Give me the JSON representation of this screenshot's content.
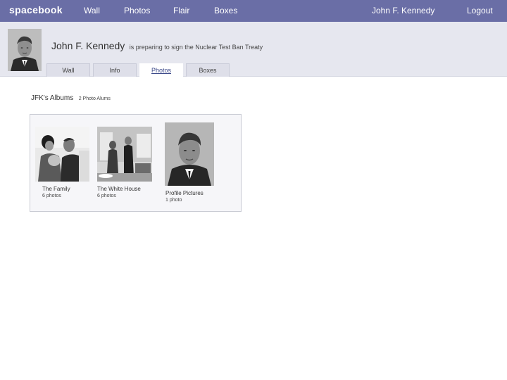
{
  "topbar": {
    "brand": "spacebook",
    "nav": [
      "Wall",
      "Photos",
      "Flair",
      "Boxes"
    ],
    "user": "John F. Kennedy",
    "logout": "Logout",
    "color": "#6a6ea6"
  },
  "profile": {
    "name": "John F. Kennedy",
    "status": "is preparing to sign the Nuclear Test Ban Treaty",
    "tabs": [
      "Wall",
      "Info",
      "Photos",
      "Boxes"
    ],
    "active_tab": "Photos"
  },
  "albums": {
    "heading": "JFK's Albums",
    "count": "2 Photo Alums",
    "items": [
      {
        "name": "The Family",
        "count": "6 photos"
      },
      {
        "name": "The White House",
        "count": "6 photos"
      },
      {
        "name": "Profile Pictures",
        "count": "1 photo"
      }
    ]
  }
}
